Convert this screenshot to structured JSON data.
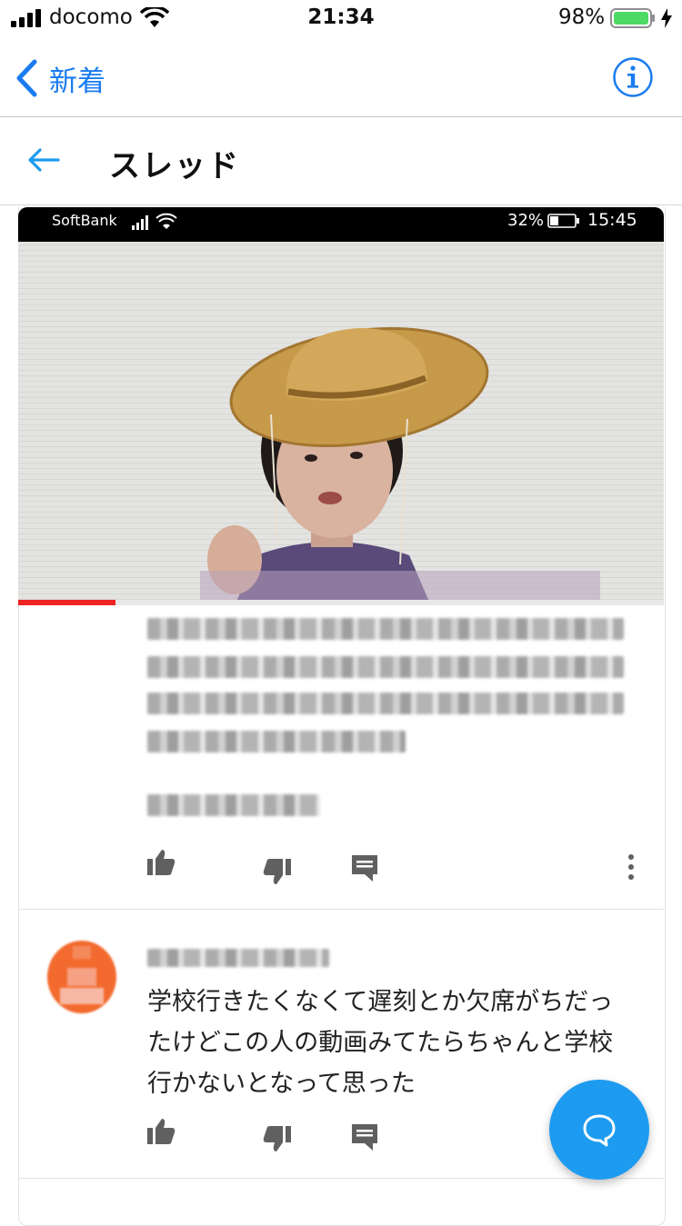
{
  "status_bar": {
    "carrier": "docomo",
    "time": "21:34",
    "battery": "98%"
  },
  "nav": {
    "back_label": "新着",
    "info_icon": "info-circle-icon"
  },
  "header": {
    "title": "スレッド",
    "back_icon": "arrow-left-icon"
  },
  "embedded_screenshot": {
    "carrier": "SoftBank",
    "battery": "32%",
    "time": "15:45",
    "video_progress": 0.15
  },
  "comment": {
    "text_lines": [
      "学校行きたくなくて遅刻とか欠席がちだっ",
      "たけどこの人の動画みてたらちゃんと学校",
      "行かないとなって思った"
    ],
    "actions": [
      "thumb-up-icon",
      "thumb-down-icon",
      "reply-icon"
    ]
  },
  "fab": {
    "icon": "chat-bubble-icon"
  },
  "colors": {
    "ios_blue": "#1a7cf0",
    "twitter_blue": "#1d9bf0",
    "progress_red": "#e22222"
  }
}
